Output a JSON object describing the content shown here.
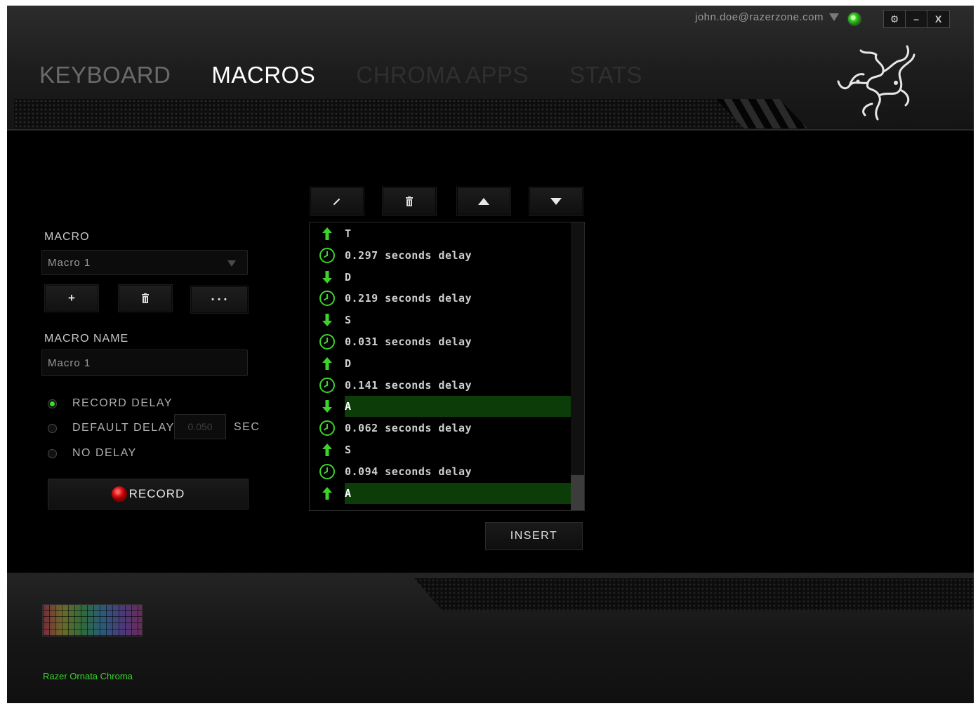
{
  "account": {
    "email": "john.doe@razerzone.com"
  },
  "window_buttons": {
    "settings": "⚙",
    "minimize": "–",
    "close": "X"
  },
  "tabs": [
    {
      "label": "KEYBOARD",
      "state": "inactive"
    },
    {
      "label": "MACROS",
      "state": "active"
    },
    {
      "label": "CHROMA APPS",
      "state": "disabled"
    },
    {
      "label": "STATS",
      "state": "disabled"
    }
  ],
  "macro_panel": {
    "macro_label": "MACRO",
    "macro_selected": "Macro 1",
    "add_label": "+",
    "more_label": "• • •",
    "name_label": "MACRO NAME",
    "name_value": "Macro 1",
    "record_options": [
      {
        "label": "RECORD DELAY",
        "checked": true
      },
      {
        "label": "DEFAULT DELAY",
        "checked": false
      },
      {
        "label": "NO DELAY",
        "checked": false
      }
    ],
    "default_delay_value": "0.050",
    "sec_label": "SEC",
    "record_label": "RECORD"
  },
  "event_list": {
    "events": [
      {
        "type": "key-up",
        "text": "T",
        "selected": false
      },
      {
        "type": "delay",
        "text": "0.297 seconds delay",
        "selected": false
      },
      {
        "type": "key-down",
        "text": "D",
        "selected": false
      },
      {
        "type": "delay",
        "text": "0.219 seconds delay",
        "selected": false
      },
      {
        "type": "key-down",
        "text": "S",
        "selected": false
      },
      {
        "type": "delay",
        "text": "0.031 seconds delay",
        "selected": false
      },
      {
        "type": "key-up",
        "text": "D",
        "selected": false
      },
      {
        "type": "delay",
        "text": "0.141 seconds delay",
        "selected": false
      },
      {
        "type": "key-down",
        "text": "A",
        "selected": true
      },
      {
        "type": "delay",
        "text": "0.062 seconds delay",
        "selected": false
      },
      {
        "type": "key-up",
        "text": "S",
        "selected": false
      },
      {
        "type": "delay",
        "text": "0.094 seconds delay",
        "selected": false
      },
      {
        "type": "key-up",
        "text": "A",
        "selected": true
      }
    ],
    "insert_label": "INSERT"
  },
  "device": {
    "name": "Razer Ornata Chroma"
  },
  "colors": {
    "accent": "#3ed22c",
    "selected_row": "#0c3c08",
    "record": "#e31515"
  }
}
